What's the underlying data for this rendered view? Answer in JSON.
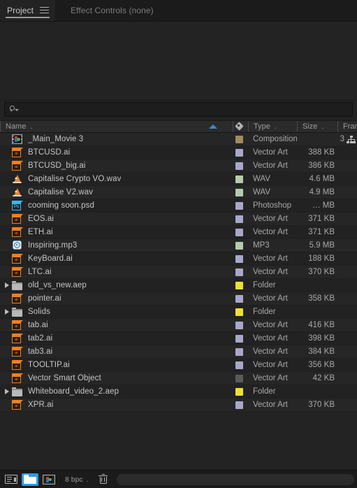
{
  "tabs": [
    {
      "label": "Project",
      "active": true,
      "menu_icon": "hamburger-icon"
    },
    {
      "label": "Effect Controls (none)",
      "active": false
    }
  ],
  "search": {
    "placeholder": "",
    "value": "",
    "icon": "search-icon",
    "dropdown_icon": "caret-down-icon"
  },
  "columns": {
    "name": "Name",
    "name_dot": ".",
    "label_icon": "tag-icon",
    "type": "Type",
    "type_dot": ".",
    "size": "Size",
    "size_dot": ".",
    "frame": "Frame",
    "sort_indicator": "sort-ascending-arrow",
    "sort_color": "#3a86d8"
  },
  "label_colors": {
    "composition_tan": "#a08963",
    "vector_lavender": "#a8a8cc",
    "audio_green": "#b5ccab",
    "folder_yellow": "#efe02e",
    "none_gray": "#5a5a5a"
  },
  "items": [
    {
      "name": "_Main_Movie 3",
      "icon": "composition-icon",
      "swatch": "#a08963",
      "type": "Composition",
      "size": "",
      "frame": "3",
      "frame_icon": "network-icon",
      "expandable": false
    },
    {
      "name": "BTCUSD.ai",
      "icon": "illustrator-icon",
      "swatch": "#a8a8cc",
      "type": "Vector Art",
      "size": "388 KB",
      "frame": "",
      "expandable": false
    },
    {
      "name": "BTCUSD_big.ai",
      "icon": "illustrator-icon",
      "swatch": "#a8a8cc",
      "type": "Vector Art",
      "size": "386 KB",
      "frame": "",
      "expandable": false
    },
    {
      "name": "Capitalise Crypto VO.wav",
      "icon": "wav-cone-icon",
      "swatch": "#b5ccab",
      "type": "WAV",
      "size": "4.6 MB",
      "frame": "",
      "expandable": false
    },
    {
      "name": "Capitalise V2.wav",
      "icon": "wav-cone-icon",
      "swatch": "#b5ccab",
      "type": "WAV",
      "size": "4.9 MB",
      "frame": "",
      "expandable": false
    },
    {
      "name": "cooming soon.psd",
      "icon": "photoshop-icon",
      "swatch": "#a8a8cc",
      "type": "Photoshop",
      "size": "… MB",
      "frame": "",
      "expandable": false
    },
    {
      "name": "EOS.ai",
      "icon": "illustrator-icon",
      "swatch": "#a8a8cc",
      "type": "Vector Art",
      "size": "371 KB",
      "frame": "",
      "expandable": false
    },
    {
      "name": "ETH.ai",
      "icon": "illustrator-icon",
      "swatch": "#a8a8cc",
      "type": "Vector Art",
      "size": "371 KB",
      "frame": "",
      "expandable": false
    },
    {
      "name": "Inspiring.mp3",
      "icon": "mp3-disc-icon",
      "swatch": "#b5ccab",
      "type": "MP3",
      "size": "5.9 MB",
      "frame": "",
      "expandable": false
    },
    {
      "name": "KeyBoard.ai",
      "icon": "illustrator-icon",
      "swatch": "#a8a8cc",
      "type": "Vector Art",
      "size": "188 KB",
      "frame": "",
      "expandable": false
    },
    {
      "name": "LTC.ai",
      "icon": "illustrator-icon",
      "swatch": "#a8a8cc",
      "type": "Vector Art",
      "size": "370 KB",
      "frame": "",
      "expandable": false
    },
    {
      "name": "old_vs_new.aep",
      "icon": "folder-icon",
      "swatch": "#efe02e",
      "type": "Folder",
      "size": "",
      "frame": "",
      "expandable": true
    },
    {
      "name": "pointer.ai",
      "icon": "illustrator-icon",
      "swatch": "#a8a8cc",
      "type": "Vector Art",
      "size": "358 KB",
      "frame": "",
      "expandable": false
    },
    {
      "name": "Solids",
      "icon": "folder-icon",
      "swatch": "#efe02e",
      "type": "Folder",
      "size": "",
      "frame": "",
      "expandable": true
    },
    {
      "name": "tab.ai",
      "icon": "illustrator-icon",
      "swatch": "#a8a8cc",
      "type": "Vector Art",
      "size": "416 KB",
      "frame": "",
      "expandable": false
    },
    {
      "name": "tab2.ai",
      "icon": "illustrator-icon",
      "swatch": "#a8a8cc",
      "type": "Vector Art",
      "size": "398 KB",
      "frame": "",
      "expandable": false
    },
    {
      "name": "tab3.ai",
      "icon": "illustrator-icon",
      "swatch": "#a8a8cc",
      "type": "Vector Art",
      "size": "384 KB",
      "frame": "",
      "expandable": false
    },
    {
      "name": "TOOLTIP.ai",
      "icon": "illustrator-icon",
      "swatch": "#a8a8cc",
      "type": "Vector Art",
      "size": "356 KB",
      "frame": "",
      "expandable": false
    },
    {
      "name": "Vector Smart Object",
      "icon": "illustrator-icon",
      "swatch": "#5a5a5a",
      "type": "Vector Art",
      "size": "42 KB",
      "frame": "",
      "expandable": false
    },
    {
      "name": "Whiteboard_video_2.aep",
      "icon": "folder-icon",
      "swatch": "#efe02e",
      "type": "Folder",
      "size": "",
      "frame": "",
      "expandable": true
    },
    {
      "name": "XPR.ai",
      "icon": "illustrator-icon",
      "swatch": "#a8a8cc",
      "type": "Vector Art",
      "size": "370 KB",
      "frame": "",
      "expandable": false
    }
  ],
  "bottom_bar": {
    "project_settings_icon": "project-settings-icon",
    "new_folder_icon": "new-folder-icon",
    "new_comp_icon": "new-composition-icon",
    "bit_depth": "8 bpc",
    "bit_depth_dot": ".",
    "delete_icon": "trash-icon",
    "selected_accent": "#2d9ae8"
  }
}
